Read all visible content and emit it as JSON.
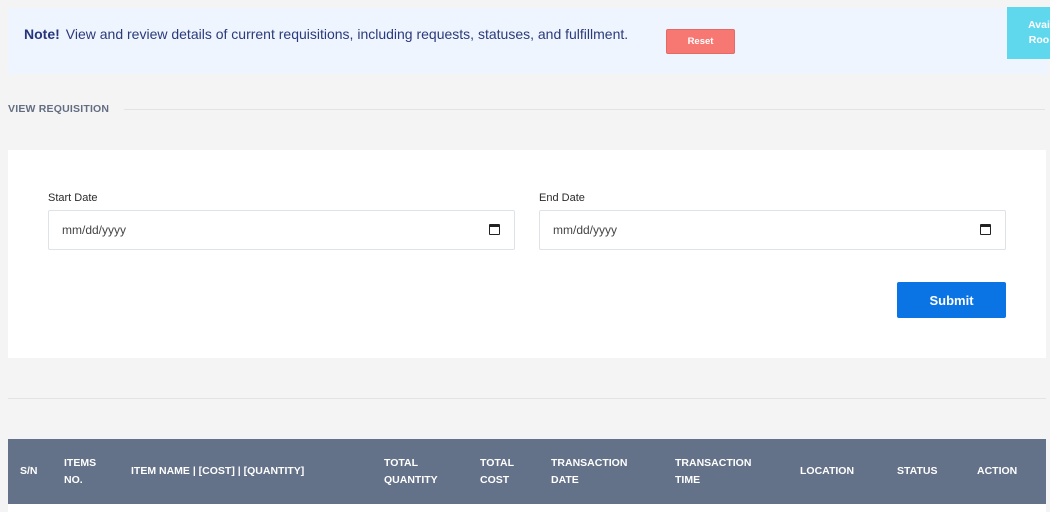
{
  "note": {
    "label": "Note!",
    "message": "View and review details of current requisitions, including requests, statuses, and fulfillment.",
    "reset_label": "Reset",
    "avail_line1": "Avai",
    "avail_line2": "Roo"
  },
  "section": {
    "title": "VIEW REQUISITION"
  },
  "form": {
    "start_date_label": "Start Date",
    "start_date_placeholder": "mm/dd/yyyy",
    "end_date_label": "End Date",
    "end_date_placeholder": "mm/dd/yyyy",
    "submit_label": "Submit"
  },
  "table": {
    "columns": [
      [
        "S/N"
      ],
      [
        "ITEMS",
        "NO."
      ],
      [
        "ITEM NAME | [COST] | [QUANTITY]"
      ],
      [
        "TOTAL",
        "QUANTITY"
      ],
      [
        "TOTAL",
        "COST"
      ],
      [
        "TRANSACTION",
        "DATE"
      ],
      [
        "TRANSACTION",
        "TIME"
      ],
      [
        "LOCATION"
      ],
      [
        "STATUS"
      ],
      [
        "ACTION"
      ]
    ]
  },
  "colors": {
    "accent": "#0a74e4",
    "reset": "#f77772",
    "avail": "#5fd8ee",
    "table_header": "#637189",
    "note_bg": "#eef5ff"
  }
}
